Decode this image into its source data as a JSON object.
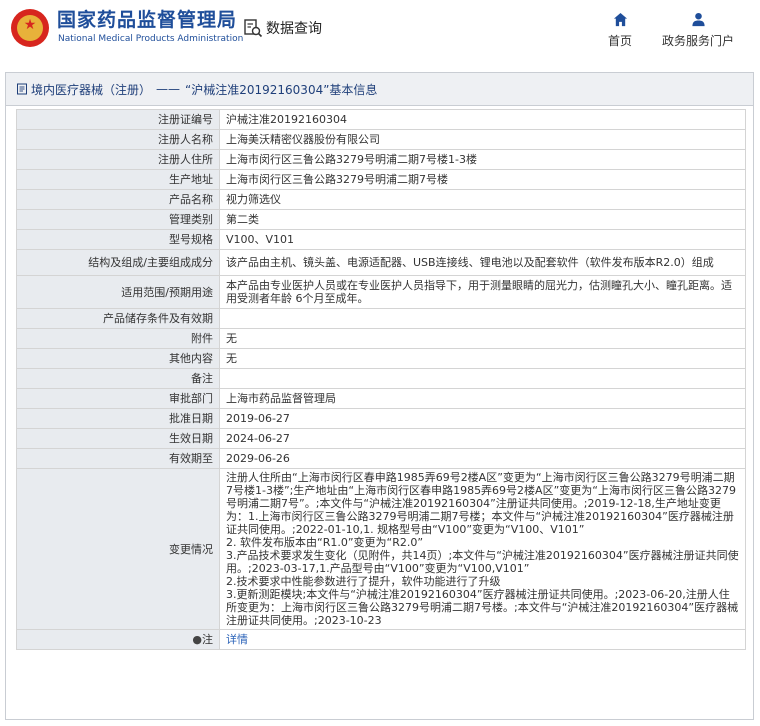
{
  "header": {
    "logo_cn": "国家药品监督管理局",
    "logo_en": "National Medical Products Administration",
    "query_label": "数据查询",
    "nav": {
      "home": "首页",
      "portal": "政务服务门户"
    }
  },
  "panel": {
    "breadcrumb_section": "境内医疗器械（注册）",
    "breadcrumb_sep": "——",
    "breadcrumb_title": "“沪械注准20192160304”基本信息"
  },
  "record": {
    "rows": [
      {
        "label": "注册证编号",
        "value": "沪械注准20192160304"
      },
      {
        "label": "注册人名称",
        "value": "上海美沃精密仪器股份有限公司"
      },
      {
        "label": "注册人住所",
        "value": "上海市闵行区三鲁公路3279号明浦二期7号楼1-3楼"
      },
      {
        "label": "生产地址",
        "value": "上海市闵行区三鲁公路3279号明浦二期7号楼"
      },
      {
        "label": "产品名称",
        "value": "视力筛选仪"
      },
      {
        "label": "管理类别",
        "value": "第二类"
      },
      {
        "label": "型号规格",
        "value": "V100、V101"
      },
      {
        "label": "结构及组成/主要组成成分",
        "value": "该产品由主机、镜头盖、电源适配器、USB连接线、锂电池以及配套软件（软件发布版本R2.0）组成"
      },
      {
        "label": "适用范围/预期用途",
        "value": "本产品由专业医护人员或在专业医护人员指导下，用于测量眼睛的屈光力，估测瞳孔大小、瞳孔距离。适用受测者年龄 6个月至成年。"
      },
      {
        "label": "产品储存条件及有效期",
        "value": ""
      },
      {
        "label": "附件",
        "value": "无"
      },
      {
        "label": "其他内容",
        "value": "无"
      },
      {
        "label": "备注",
        "value": ""
      },
      {
        "label": "审批部门",
        "value": "上海市药品监督管理局"
      },
      {
        "label": "批准日期",
        "value": "2019-06-27"
      },
      {
        "label": "生效日期",
        "value": "2024-06-27"
      },
      {
        "label": "有效期至",
        "value": "2029-06-26"
      }
    ],
    "change_label": "变更情况",
    "change_text": "注册人住所由“上海市闵行区春申路1985弄69号2楼A区”变更为“上海市闵行区三鲁公路3279号明浦二期7号楼1-3楼”;生产地址由“上海市闵行区春申路1985弄69号2楼A区”变更为“上海市闵行区三鲁公路3279号明浦二期7号”。;本文件与“沪械注准20192160304”注册证共同使用。;2019-12-18,生产地址变更为：1.上海市闵行区三鲁公路3279号明浦二期7号楼；本文件与“沪械注准20192160304”医疗器械注册证共同使用。;2022-01-10,1. 规格型号由“V100”变更为“V100、V101”\n2. 软件发布版本由“R1.0”变更为“R2.0”\n3.产品技术要求发生变化（见附件，共14页）;本文件与“沪械注准20192160304”医疗器械注册证共同使用。;2023-03-17,1.产品型号由“V100”变更为“V100,V101”\n2.技术要求中性能参数进行了提升，软件功能进行了升级\n3.更新测距模块;本文件与“沪械注准20192160304”医疗器械注册证共同使用。;2023-06-20,注册人住所变更为：上海市闵行区三鲁公路3279号明浦二期7号楼。;本文件与“沪械注准20192160304”医疗器械注册证共同使用。;2023-10-23",
    "note_label": "注",
    "note_link": "详情"
  },
  "colors": {
    "brand_blue": "#1f4e9a",
    "emblem_red": "#d7261e",
    "label_bg": "#e8ebef",
    "link": "#2a62b8"
  }
}
